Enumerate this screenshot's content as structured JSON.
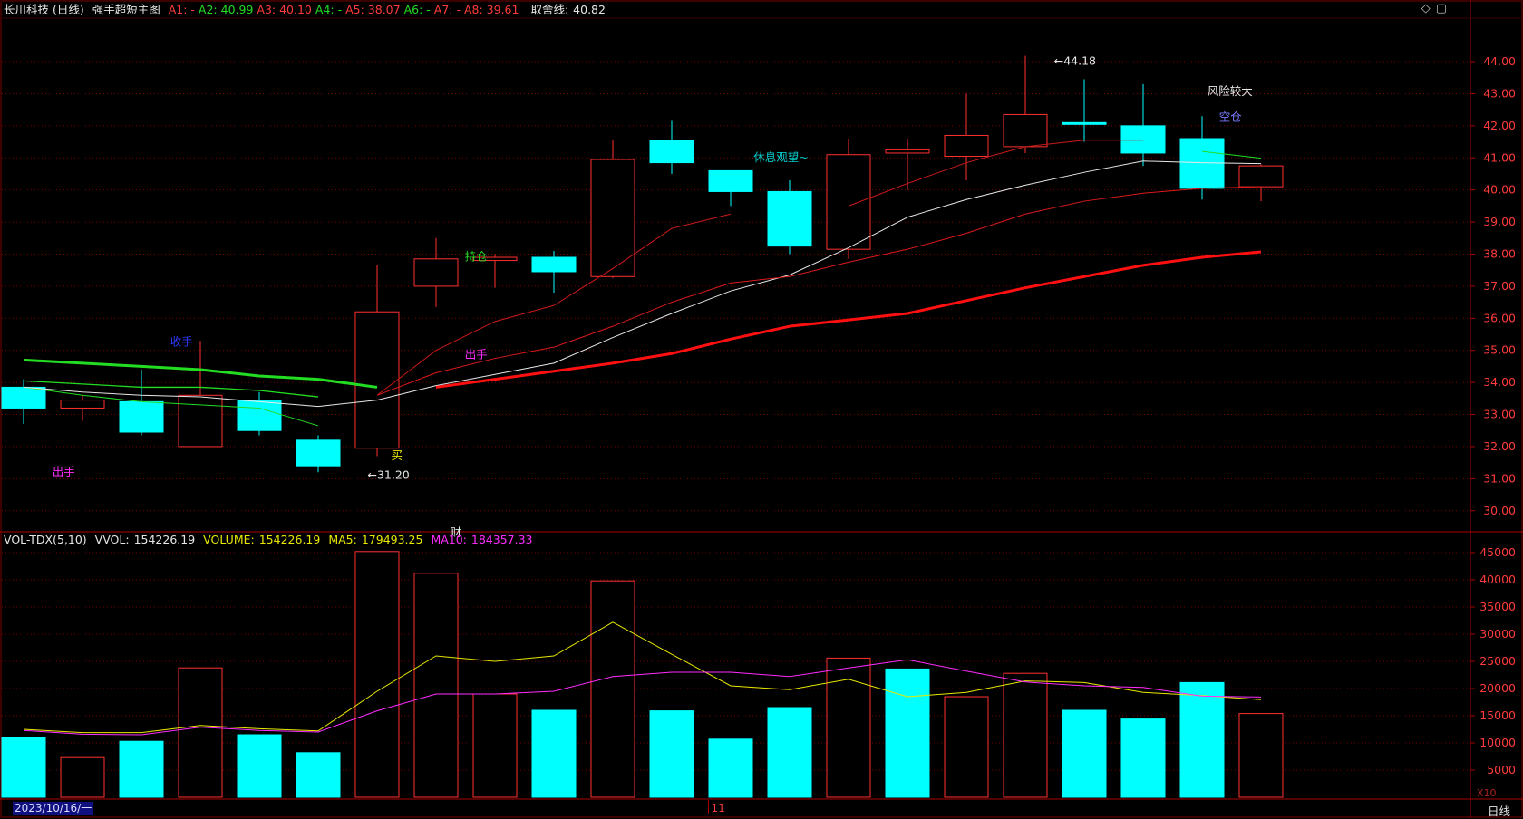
{
  "header": {
    "stock": "长川科技 (日线)",
    "indicator": "强手超短主图",
    "values": [
      {
        "label": "A1:",
        "value": "-",
        "color": "#ff3b3b"
      },
      {
        "label": "A2:",
        "value": "40.99",
        "color": "#22dd22"
      },
      {
        "label": "A3:",
        "value": "40.10",
        "color": "#ff3b3b"
      },
      {
        "label": "A4:",
        "value": "-",
        "color": "#22dd22"
      },
      {
        "label": "A5:",
        "value": "38.07",
        "color": "#ff3b3b"
      },
      {
        "label": "A6:",
        "value": "-",
        "color": "#22dd22"
      },
      {
        "label": "A7:",
        "value": "-",
        "color": "#ff3b3b"
      },
      {
        "label": "A8:",
        "value": "39.61",
        "color": "#ff3b3b"
      }
    ],
    "quse_label": "取舍线:",
    "quse_value": "40.82"
  },
  "vol_header": {
    "name": "VOL-TDX(5,10)",
    "vvol_label": "VVOL:",
    "vvol_value": "154226.19",
    "volume_label": "VOLUME:",
    "volume_value": "154226.19",
    "ma5_label": "MA5:",
    "ma5_value": "179493.25",
    "ma10_label": "MA10:",
    "ma10_value": "184357.33"
  },
  "footer": {
    "start_date": "2023/10/16/一",
    "month_mark": "11",
    "timeframe": "日线",
    "vol_unit": "X10"
  },
  "top_icons": [
    "diamond-icon",
    "square-icon"
  ],
  "colors": {
    "up": "#ff3030",
    "down": "#00ffff",
    "bg": "#000000",
    "grid": "#7a0000",
    "axis_text": "#ff3b3b"
  },
  "chart_data": [
    {
      "type": "candlestick",
      "title": "强手超短主图",
      "ylim": [
        29.4,
        45.3
      ],
      "yticks": [
        30,
        31,
        32,
        33,
        34,
        35,
        36,
        37,
        38,
        39,
        40,
        41,
        42,
        43,
        44
      ],
      "ytick_labels": [
        "30.00",
        "31.00",
        "32.00",
        "33.00",
        "34.00",
        "35.00",
        "36.00",
        "37.00",
        "38.00",
        "39.00",
        "40.00",
        "41.00",
        "42.00",
        "43.00",
        "44.00"
      ],
      "candles": [
        {
          "open": 33.85,
          "high": 34.1,
          "low": 32.7,
          "close": 33.2
        },
        {
          "open": 33.2,
          "high": 33.6,
          "low": 32.8,
          "close": 33.45
        },
        {
          "open": 33.4,
          "high": 34.4,
          "low": 32.35,
          "close": 32.45
        },
        {
          "open": 32.0,
          "high": 35.3,
          "low": 32.0,
          "close": 33.6
        },
        {
          "open": 33.45,
          "high": 33.7,
          "low": 32.35,
          "close": 32.5
        },
        {
          "open": 32.2,
          "high": 32.35,
          "low": 31.2,
          "close": 31.4
        },
        {
          "open": 31.95,
          "high": 37.65,
          "low": 31.7,
          "close": 36.2
        },
        {
          "open": 37.0,
          "high": 38.5,
          "low": 36.35,
          "close": 37.85
        },
        {
          "open": 37.8,
          "high": 38.0,
          "low": 36.95,
          "close": 37.9
        },
        {
          "open": 37.9,
          "high": 38.1,
          "low": 36.8,
          "close": 37.45
        },
        {
          "open": 37.3,
          "high": 41.55,
          "low": 37.25,
          "close": 40.95
        },
        {
          "open": 41.55,
          "high": 42.15,
          "low": 40.5,
          "close": 40.85
        },
        {
          "open": 40.6,
          "high": 40.6,
          "low": 39.5,
          "close": 39.95
        },
        {
          "open": 39.95,
          "high": 40.3,
          "low": 38.0,
          "close": 38.25
        },
        {
          "open": 38.15,
          "high": 41.6,
          "low": 37.85,
          "close": 41.1
        },
        {
          "open": 41.15,
          "high": 41.6,
          "low": 40.0,
          "close": 41.25
        },
        {
          "open": 41.05,
          "high": 43.0,
          "low": 40.3,
          "close": 41.7
        },
        {
          "open": 41.35,
          "high": 44.18,
          "low": 41.15,
          "close": 42.35
        },
        {
          "open": 42.1,
          "high": 43.45,
          "low": 41.5,
          "close": 42.05
        },
        {
          "open": 42.0,
          "high": 43.3,
          "low": 40.75,
          "close": 41.15
        },
        {
          "open": 41.6,
          "high": 42.3,
          "low": 39.7,
          "close": 40.05
        },
        {
          "open": 40.1,
          "high": 40.8,
          "low": 39.65,
          "close": 40.75
        }
      ],
      "lines": [
        {
          "name": "green-upper",
          "color": "#22dd22",
          "width": 3,
          "start": 0,
          "values": [
            34.7,
            34.6,
            34.5,
            34.4,
            34.2,
            34.1,
            33.85
          ]
        },
        {
          "name": "green-mid",
          "color": "#22dd22",
          "width": 1.3,
          "start": 0,
          "values": [
            34.05,
            33.95,
            33.85,
            33.85,
            33.75,
            33.55
          ]
        },
        {
          "name": "green-low",
          "color": "#22dd22",
          "width": 1,
          "start": 0,
          "values": [
            33.85,
            33.6,
            33.4,
            33.3,
            33.2,
            32.65
          ]
        },
        {
          "name": "white-ma",
          "color": "#e8e8e8",
          "width": 1,
          "start": 0,
          "values": [
            33.85,
            33.7,
            33.6,
            33.55,
            33.4,
            33.25,
            33.45,
            33.9,
            34.25,
            34.6,
            35.4,
            36.15,
            36.85,
            37.35,
            38.2,
            39.15,
            39.7,
            40.15,
            40.55,
            40.9,
            40.85,
            40.82
          ]
        },
        {
          "name": "red-thick",
          "color": "#ff1010",
          "width": 3,
          "start": 7,
          "values": [
            33.85,
            34.1,
            34.35,
            34.6,
            34.9,
            35.35,
            35.75,
            35.95,
            36.15,
            36.55,
            36.95,
            37.3,
            37.65,
            37.9,
            38.07
          ]
        },
        {
          "name": "red-thin-a",
          "color": "#dd1a1a",
          "width": 1,
          "start": 6,
          "values": [
            33.6,
            34.3,
            34.75,
            35.1,
            35.75,
            36.5,
            37.1,
            37.3,
            37.75,
            38.15,
            38.65,
            39.25,
            39.65,
            39.9,
            40.05,
            40.1
          ]
        },
        {
          "name": "red-thin-b",
          "color": "#cc1a1a",
          "width": 1,
          "start": 6,
          "values": [
            33.6,
            35.0,
            35.9,
            36.4,
            37.55,
            38.8,
            39.25
          ]
        },
        {
          "name": "red-thin-c",
          "color": "#cc1a1a",
          "width": 1,
          "start": 14,
          "values": [
            39.5,
            40.2,
            40.85,
            41.35,
            41.55,
            41.55
          ]
        },
        {
          "name": "green-end",
          "color": "#22dd22",
          "width": 1,
          "start": 20,
          "values": [
            41.2,
            40.99
          ]
        }
      ],
      "annotations": [
        {
          "text": "出手",
          "bar": 0.55,
          "price": 31.1,
          "color": "#ff2cff"
        },
        {
          "text": "收手",
          "bar": 2.55,
          "price": 35.15,
          "color": "#2f39ff"
        },
        {
          "text": "←31.20",
          "bar": 5.9,
          "price": 31.0,
          "color": "#e6e6e6"
        },
        {
          "text": "买",
          "bar": 6.3,
          "price": 31.6,
          "color": "#e8e800"
        },
        {
          "text": "出手",
          "bar": 7.55,
          "price": 34.75,
          "color": "#ff2cff"
        },
        {
          "text": "持仓",
          "bar": 7.55,
          "price": 37.8,
          "color": "#22dd22"
        },
        {
          "text": "休息观望~",
          "bar": 12.45,
          "price": 40.9,
          "color": "#00cccc"
        },
        {
          "text": "←44.18",
          "bar": 17.55,
          "price": 43.9,
          "color": "#e6e6e6"
        },
        {
          "text": "风险较大",
          "bar": 20.15,
          "price": 42.95,
          "color": "#e6e6e6"
        },
        {
          "text": "空仓",
          "bar": 20.35,
          "price": 42.15,
          "color": "#7a7aff"
        },
        {
          "text": "财",
          "bar": 7.3,
          "price": 29.2,
          "color": "#e6e6e6"
        }
      ]
    },
    {
      "type": "bar",
      "title": "VOL-TDX(5,10)",
      "unit": "X10",
      "ylim": [
        0,
        46000
      ],
      "yticks": [
        5000,
        10000,
        15000,
        20000,
        25000,
        30000,
        35000,
        40000,
        45000
      ],
      "ytick_labels": [
        "5000",
        "10000",
        "15000",
        "20000",
        "25000",
        "30000",
        "35000",
        "40000",
        "45000"
      ],
      "values": [
        11000,
        7300,
        10300,
        23800,
        11500,
        8200,
        45200,
        41200,
        19000,
        16000,
        39800,
        15900,
        10700,
        16500,
        25600,
        23600,
        18500,
        22800,
        16000,
        14400,
        21100,
        15400
      ],
      "up": [
        false,
        true,
        false,
        true,
        false,
        false,
        true,
        true,
        true,
        false,
        true,
        false,
        false,
        false,
        true,
        false,
        true,
        true,
        false,
        false,
        false,
        true
      ],
      "series": [
        {
          "name": "MA5",
          "color": "#e8e800",
          "values": [
            12500,
            11900,
            11900,
            13200,
            12600,
            12200,
            19500,
            26000,
            25000,
            26000,
            32200,
            26300,
            20500,
            19800,
            21700,
            18500,
            19300,
            21400,
            21100,
            19300,
            18700,
            17950
          ]
        },
        {
          "name": "MA10",
          "color": "#ff2cff",
          "values": [
            12300,
            11600,
            11500,
            12900,
            12300,
            12000,
            15900,
            19000,
            19000,
            19500,
            22200,
            23000,
            23000,
            22200,
            23800,
            25300,
            23200,
            21200,
            20500,
            20200,
            18600,
            18430
          ]
        }
      ]
    }
  ]
}
